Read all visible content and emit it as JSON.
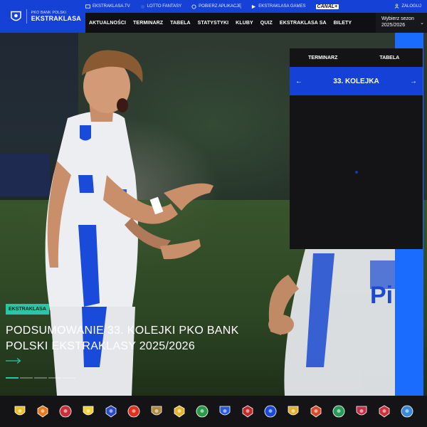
{
  "logo": {
    "small": "PKO BANK POLSKI",
    "big": "EKSTRAKLASA"
  },
  "util_links": [
    {
      "label": "EKSTRAKLASA.TV",
      "icon": "tv-icon"
    },
    {
      "label": "LOTTO FANTASY",
      "icon": "lotto-icon"
    },
    {
      "label": "POBIERZ APLIKACJĘ",
      "icon": "app-icon"
    },
    {
      "label": "EKSTRAKLASA GAMES",
      "icon": "games-icon"
    }
  ],
  "canal": "CANAL+",
  "login": "ZALOGUJ",
  "nav": [
    "AKTUALNOŚCI",
    "TERMINARZ",
    "TABELA",
    "STATYSTYKI",
    "KLUBY",
    "QUIZ",
    "EKSTRAKLASA SA",
    "BILETY"
  ],
  "season": {
    "label": "Wybierz sezon",
    "value": "2025/2026"
  },
  "hero": {
    "tag": "EKSTRAKLASA",
    "headline": "PODSUMOWANIE 33. KOLEJKI PKO BANK POLSKI EKSTRAKLASY 2025/2026"
  },
  "panel": {
    "tabs": [
      "TERMINARZ",
      "TABELA"
    ],
    "round": "33. KOLEJKA"
  },
  "clubs": [
    {
      "icon": "club-crest-icon",
      "color": "#e8c02a"
    },
    {
      "icon": "club-crest-icon",
      "color": "#e87a1a"
    },
    {
      "icon": "club-crest-icon",
      "color": "#c9303a"
    },
    {
      "icon": "club-crest-icon",
      "color": "#f2d23a"
    },
    {
      "icon": "club-crest-icon",
      "color": "#2a4ac9"
    },
    {
      "icon": "club-crest-icon",
      "color": "#e0301e"
    },
    {
      "icon": "club-crest-icon",
      "color": "#b0893a"
    },
    {
      "icon": "club-crest-icon",
      "color": "#e2b628"
    },
    {
      "icon": "club-crest-icon",
      "color": "#2a9a4a"
    },
    {
      "icon": "club-crest-icon",
      "color": "#2a5ad9"
    },
    {
      "icon": "club-crest-icon",
      "color": "#c02a2a"
    },
    {
      "icon": "club-crest-icon",
      "color": "#1a4ad9"
    },
    {
      "icon": "club-crest-icon",
      "color": "#e0b030"
    },
    {
      "icon": "club-crest-icon",
      "color": "#d94a2a"
    },
    {
      "icon": "club-crest-icon",
      "color": "#2a9a5a"
    },
    {
      "icon": "club-crest-icon",
      "color": "#c0304a"
    },
    {
      "icon": "club-crest-icon",
      "color": "#d0303a"
    },
    {
      "icon": "club-crest-icon",
      "color": "#3a8ad9"
    }
  ]
}
